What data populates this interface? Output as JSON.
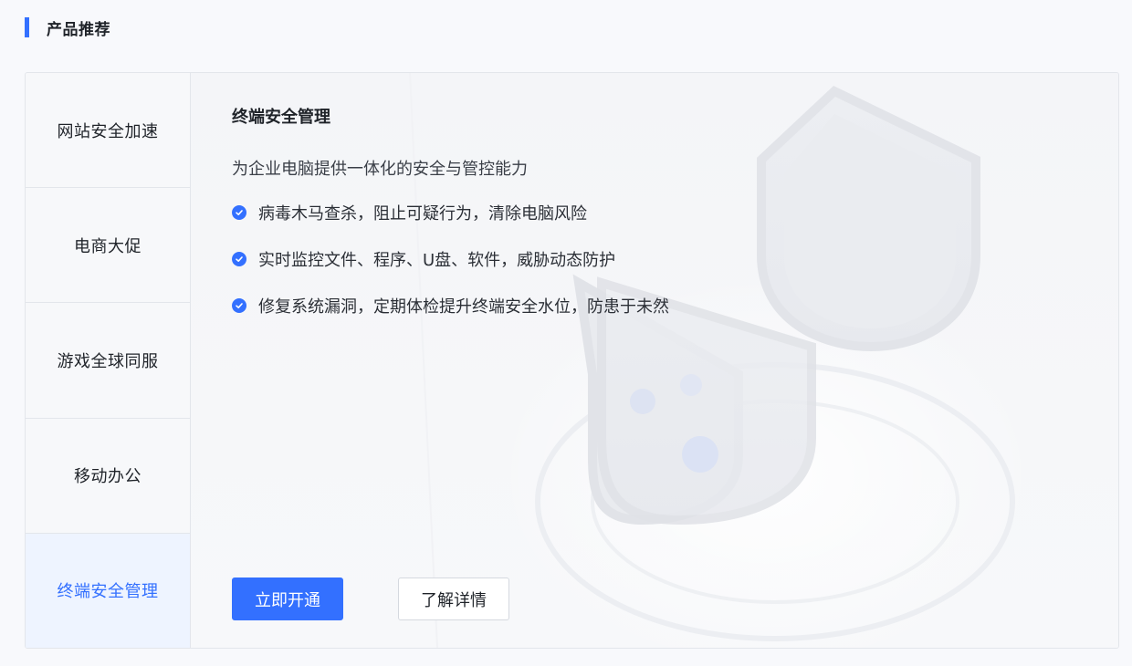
{
  "section": {
    "title": "产品推荐"
  },
  "tabs": [
    {
      "label": "网站安全加速",
      "active": false
    },
    {
      "label": "电商大促",
      "active": false
    },
    {
      "label": "游戏全球同服",
      "active": false
    },
    {
      "label": "移动办公",
      "active": false
    },
    {
      "label": "终端安全管理",
      "active": true
    }
  ],
  "product": {
    "title": "终端安全管理",
    "description": "为企业电脑提供一体化的安全与管控能力",
    "features": [
      "病毒木马查杀，阻止可疑行为，清除电脑风险",
      "实时监控文件、程序、U盘、软件，威胁动态防护",
      "修复系统漏洞，定期体检提升终端安全水位，防患于未然"
    ],
    "feature_icon": "check-circle-icon"
  },
  "actions": {
    "primary_label": "立即开通",
    "secondary_label": "了解详情"
  },
  "colors": {
    "accent": "#3370ff",
    "active_tab_bg": "#eef4ff",
    "border": "#e3e6eb"
  }
}
